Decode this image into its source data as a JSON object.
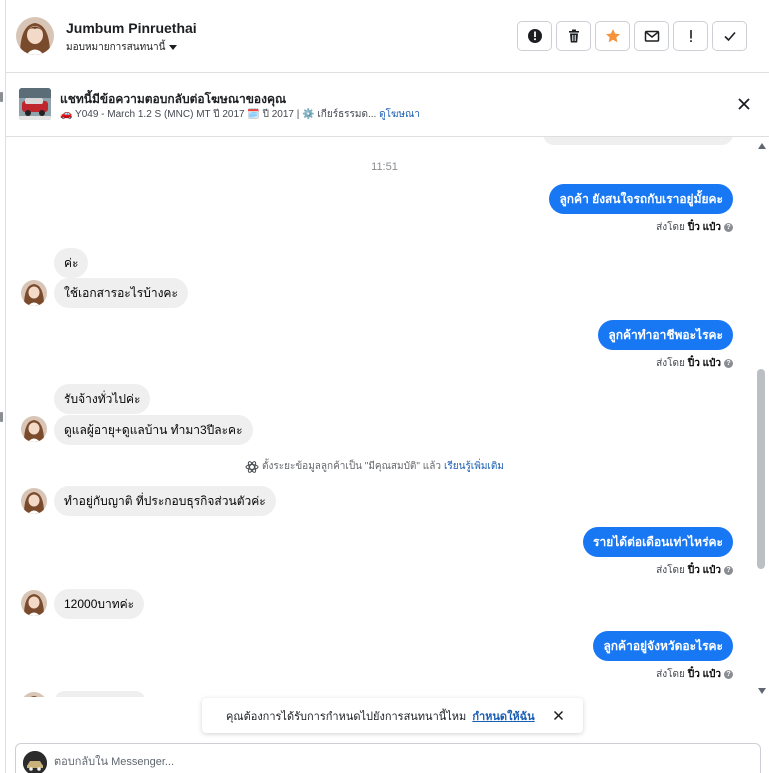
{
  "header": {
    "contact_name": "Jumbum Pinruethai",
    "assign_label": "มอบหมายการสนทนานี้",
    "actions": [
      {
        "name": "report-button",
        "icon": "alert-circle-icon"
      },
      {
        "name": "delete-button",
        "icon": "trash-icon"
      },
      {
        "name": "star-button",
        "icon": "star-icon"
      },
      {
        "name": "mark-unread-button",
        "icon": "envelope-icon"
      },
      {
        "name": "follow-up-button",
        "icon": "exclamation-icon"
      },
      {
        "name": "mark-done-button",
        "icon": "check-icon"
      }
    ]
  },
  "ad_banner": {
    "title": "แชทนี้มีข้อความตอบกลับต่อโฆษณาของคุณ",
    "subtitle": "🚗 Y049 - March 1.2 S (MNC) MT ปี 2017 🗓️ ปี 2017 | ⚙️ เกียร์ธรรมด...",
    "link": "ดูโฆษณา"
  },
  "chat": {
    "timestamp": "11:51",
    "sent_by_prefix": "ส่งโดย",
    "sent_by_name": "ปิ๋ว แป๋ว",
    "messages": {
      "m1": "ลูกค้า ยังสนใจรถกับเราอยู่มั้ยคะ",
      "m2": "ค่ะ",
      "m3": "ใช้เอกสารอะไรบ้างคะ",
      "m4": "ลูกค้าทำอาชีพอะไรคะ",
      "m5": "รับจ้างทั่วไปค่ะ",
      "m6": "ดูแลผู้อายุ+ดูแลบ้าน ทำมา3ปีละคะ",
      "m7": "ทำอยู่กับญาติ ที่ประกอบธุรกิจส่วนตัวค่ะ",
      "m8": "รายได้ต่อเดือนเท่าไหร่คะ",
      "m9": "12000บาทค่ะ",
      "m10": "ลูกค้าอยู่จังหวัดอะไรคะ"
    },
    "notice_text": "ตั้งระยะข้อมูลลูกค้าเป็น \"มีคุณสมบัติ\" แล้ว",
    "notice_link": "เรียนรู้เพิ่มเติม"
  },
  "toast": {
    "text": "คุณต้องการได้รับการกำหนดไปยังการสนทนานี้ไหม",
    "action": "กำหนดให้ฉัน"
  },
  "composer": {
    "placeholder": "ตอบกลับใน Messenger..."
  },
  "colors": {
    "accent": "#1877f2",
    "incoming_bubble": "#efefef",
    "star": "#f7923b",
    "link": "#1a5fb4"
  }
}
